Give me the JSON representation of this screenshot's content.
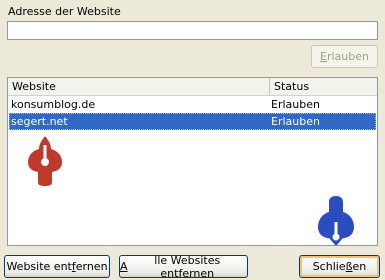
{
  "address": {
    "label": "Adresse der Website",
    "value": ""
  },
  "buttons": {
    "allow": {
      "pre": "",
      "key": "E",
      "post": "rlauben",
      "enabled": false
    },
    "remove": {
      "pre": "Website ent",
      "key": "f",
      "post": "ernen"
    },
    "remove_all": {
      "pre": "",
      "key": "A",
      "post": "lle Websites entfernen"
    },
    "close": {
      "pre": "Schlie",
      "key": "ß",
      "post": "en"
    }
  },
  "table": {
    "columns": [
      "Website",
      "Status"
    ],
    "rows": [
      {
        "site": "konsumblog.de",
        "status": "Erlauben",
        "selected": false
      },
      {
        "site": "segert.net",
        "status": "Erlauben",
        "selected": true
      }
    ]
  },
  "markers": [
    {
      "name": "red-pin-marker",
      "color": "#c0392b",
      "icon": "map-pin-icon"
    },
    {
      "name": "blue-pin-marker",
      "color": "#2a4dbf",
      "icon": "map-pin-icon"
    }
  ]
}
